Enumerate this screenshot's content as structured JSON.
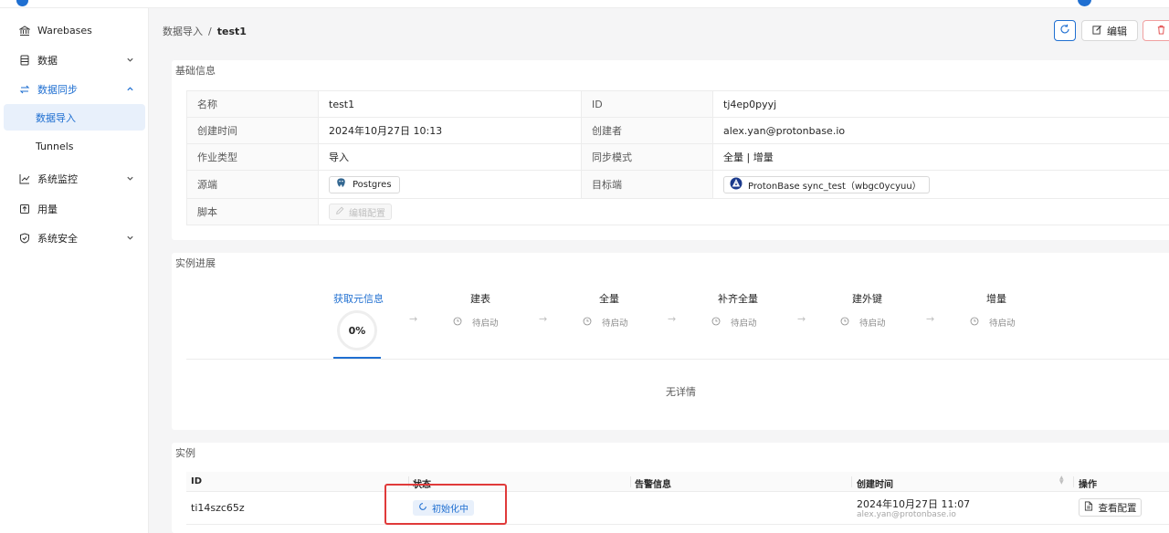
{
  "sidebar": {
    "items": [
      {
        "label": "Warebases",
        "icon": "bank-icon"
      },
      {
        "label": "数据",
        "icon": "database-icon"
      },
      {
        "label": "数据同步",
        "icon": "sync-icon"
      },
      {
        "label": "数据导入"
      },
      {
        "label": "Tunnels"
      },
      {
        "label": "系统监控",
        "icon": "chart-line-icon"
      },
      {
        "label": "用量",
        "icon": "usage-icon"
      },
      {
        "label": "系统安全",
        "icon": "shield-icon"
      }
    ]
  },
  "breadcrumb": {
    "parent": "数据导入",
    "sep": "/",
    "current": "test1"
  },
  "toolbar": {
    "edit_label": "编辑"
  },
  "basic_info": {
    "title": "基础信息",
    "rows": [
      {
        "k1": "名称",
        "v1": "test1",
        "k2": "ID",
        "v2": "tj4ep0pyyj"
      },
      {
        "k1": "创建时间",
        "v1": "2024年10月27日 10:13",
        "k2": "创建者",
        "v2": "alex.yan@protonbase.io"
      },
      {
        "k1": "作业类型",
        "v1": "导入",
        "k2": "同步模式",
        "v2": "全量 | 增量"
      },
      {
        "k1": "源端",
        "v1": "Postgres",
        "k2": "目标端",
        "v2": "ProtonBase  sync_test（wbgc0ycyuu）"
      },
      {
        "k1": "脚本",
        "v1": "编辑配置"
      }
    ]
  },
  "progress": {
    "title": "实例进展",
    "percent": "0%",
    "steps": [
      {
        "title": "获取元信息",
        "status": ""
      },
      {
        "title": "建表",
        "status": "待启动"
      },
      {
        "title": "全量",
        "status": "待启动"
      },
      {
        "title": "补齐全量",
        "status": "待启动"
      },
      {
        "title": "建外键",
        "status": "待启动"
      },
      {
        "title": "增量",
        "status": "待启动"
      }
    ],
    "arrow": "→",
    "empty_text": "无详情"
  },
  "instances": {
    "title": "实例",
    "columns": [
      "ID",
      "状态",
      "告警信息",
      "创建时间",
      "操作"
    ],
    "rows": [
      {
        "id": "ti14szc65z",
        "status": "初始化中",
        "alert": "",
        "created_time": "2024年10月27日 11:07",
        "created_by": "alex.yan@protonbase.io",
        "action": "查看配置"
      }
    ]
  },
  "colors": {
    "accent": "#1f6fd1",
    "danger": "#e03a3a"
  }
}
